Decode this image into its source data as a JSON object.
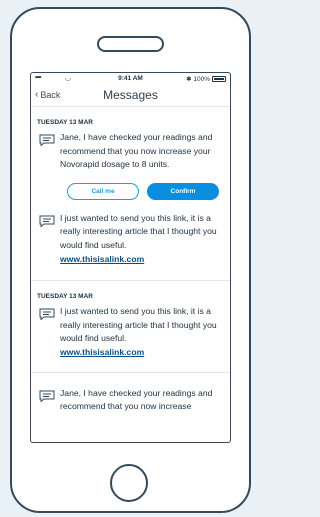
{
  "status_bar": {
    "signal": "•••••",
    "wifi": "◡",
    "time": "9:41 AM",
    "battery_text": "✱ 100%"
  },
  "nav": {
    "back_chevron": "‹",
    "back_label": "Back",
    "title": "Messages"
  },
  "groups": [
    {
      "date": "TUESDAY 13 MAR",
      "messages": [
        {
          "text": "Jane, I have checked your readings and recommend that you now increase your Novorapid dosage to 8 units.",
          "actions": {
            "call_label": "Call me",
            "confirm_label": "Confirm"
          }
        },
        {
          "text": "I just wanted to send you this link, it is a really interesting article that I thought you would find useful.",
          "link": "www.thisisalink.com"
        }
      ]
    },
    {
      "date": "TUESDAY 13 MAR",
      "messages": [
        {
          "text": "I just wanted to send you this link, it is a really interesting article that I thought you would find useful.",
          "link": "www.thisisalink.com"
        },
        {
          "text": "Jane, I have checked your readings and recommend that you now increase"
        }
      ]
    }
  ],
  "icons": {
    "message": "message-bubble-icon"
  },
  "colors": {
    "accent": "#0a8ee0",
    "frame": "#36495a",
    "background": "#e9f1f6",
    "link": "#0b4f8a"
  }
}
